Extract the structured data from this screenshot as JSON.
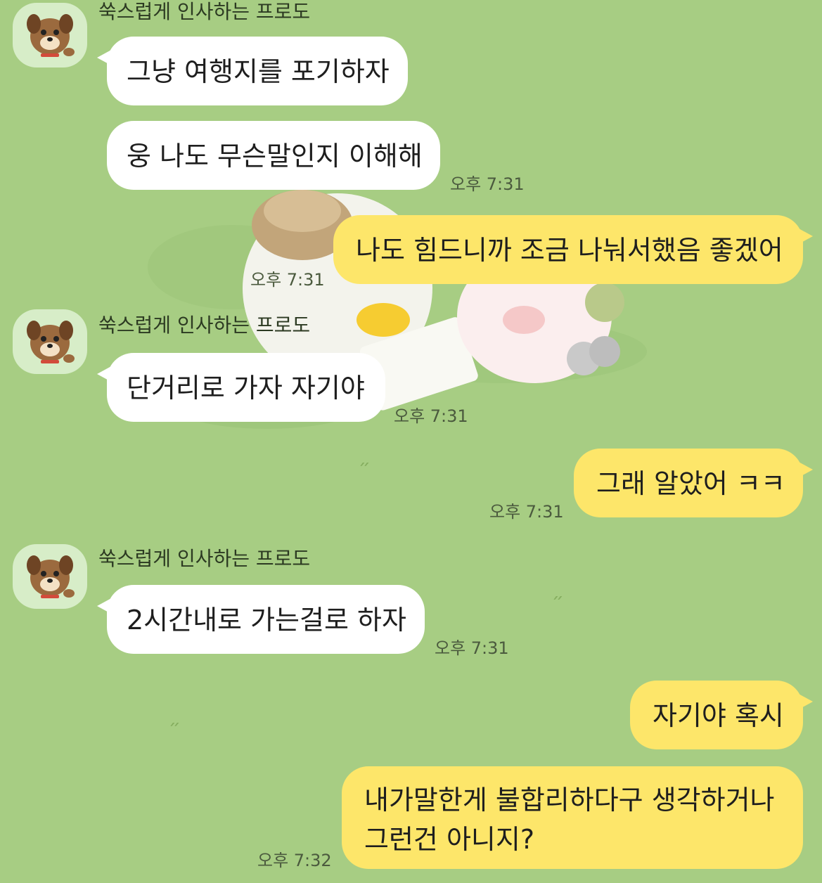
{
  "sender": {
    "name": "쑥스럽게 인사하는 프로도",
    "avatar_icon": "frodo-dog-icon"
  },
  "messages": [
    {
      "text": "그냥 여행지를 포기하자"
    },
    {
      "text": "웅 나도 무슨말인지 이해해",
      "time": "오후 7:31"
    },
    {
      "text": "나도 힘드니까 조금 나눠서했음 좋겠어",
      "time": "오후 7:31"
    },
    {
      "text": "단거리로 가자 자기야",
      "time": "오후 7:31"
    },
    {
      "text": "그래 알았어 ㅋㅋ",
      "time": "오후 7:31"
    },
    {
      "text": "2시간내로 가는걸로 하자",
      "time": "오후 7:31"
    },
    {
      "text": "자기야 혹시"
    },
    {
      "lines": [
        "내가말한게 불합리하다구 생각하거나",
        "그런건 아니지?"
      ],
      "time": "오후 7:32"
    }
  ],
  "colors": {
    "background": "#a7cd83",
    "incoming_bubble": "#ffffff",
    "outgoing_bubble": "#fde66a"
  }
}
